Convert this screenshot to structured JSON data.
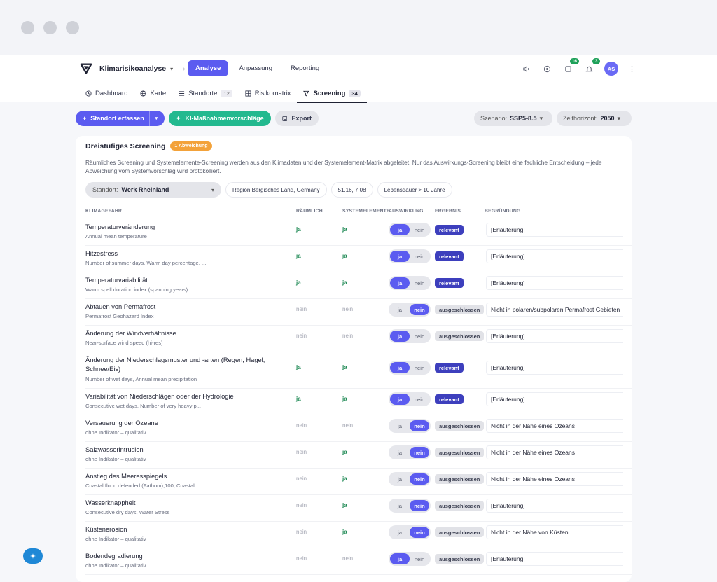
{
  "app": {
    "title": "Klimarisikoanalyse",
    "nav": [
      "Analyse",
      "Anpassung",
      "Reporting"
    ],
    "active_nav": "Analyse",
    "tasks_badge": "16",
    "notif_badge": "3",
    "avatar": "AS"
  },
  "subnav": [
    {
      "label": "Dashboard",
      "icon": "clock-icon",
      "count": ""
    },
    {
      "label": "Karte",
      "icon": "globe-icon",
      "count": ""
    },
    {
      "label": "Standorte",
      "icon": "list-icon",
      "count": "12"
    },
    {
      "label": "Risikomatrix",
      "icon": "grid-icon",
      "count": ""
    },
    {
      "label": "Screening",
      "icon": "filter-icon",
      "count": "34"
    }
  ],
  "toolbar": {
    "add_site": "Standort erfassen",
    "ai_suggestions": "KI-Maßnahmenvorschläge",
    "export": "Export",
    "scenario_label": "Szenario:",
    "scenario_value": "SSP5-8.5",
    "horizon_label": "Zeithorizont:",
    "horizon_value": "2050"
  },
  "screening": {
    "title": "Dreistufiges Screening",
    "deviation_badge": "1 Abweichung",
    "description": "Räumliches Screening und Systemelemente-Screening werden aus den Klimadaten und der Systemelement-Matrix abgeleitet. Nur das Auswirkungs-Screening bleibt eine fachliche Entscheidung – jede Abweichung vom Systemvorschlag wird protokolliert.",
    "site_label": "Standort:",
    "site_value": "Werk Rheinland",
    "chips": [
      "Region Bergisches Land, Germany",
      "51.16, 7.08",
      "Lebensdauer > 10 Jahre"
    ]
  },
  "table": {
    "headers": [
      "KLIMAGEFAHR",
      "RÄUMLICH",
      "SYSTEMELEMENTE",
      "AUSWIRKUNG",
      "ERGEBNIS",
      "BEGRÜNDUNG"
    ],
    "toggle_labels": [
      "ja",
      "nein"
    ],
    "rows": [
      {
        "name": "Temperaturveränderung",
        "sub": "Annual mean temperature",
        "spatial": "ja",
        "system": "ja",
        "impact": "ja",
        "result": "relevant",
        "reason": "[Erläuterung]"
      },
      {
        "name": "Hitzestress",
        "sub": "Number of summer days, Warm day percentage, ...",
        "spatial": "ja",
        "system": "ja",
        "impact": "ja",
        "result": "relevant",
        "reason": "[Erläuterung]"
      },
      {
        "name": "Temperaturvariabilität",
        "sub": "Warm spell duration index (spanning years)",
        "spatial": "ja",
        "system": "ja",
        "impact": "ja",
        "result": "relevant",
        "reason": "[Erläuterung]"
      },
      {
        "name": "Abtauen von Permafrost",
        "sub": "Permafrost Geohazard Index",
        "spatial": "nein",
        "system": "nein",
        "impact": "nein",
        "result": "ausgeschlossen",
        "reason": "Nicht in polaren/subpolaren Permafrost Gebieten"
      },
      {
        "name": "Änderung der Windverhältnisse",
        "sub": "Near-surface wind speed (hi-res)",
        "spatial": "nein",
        "system": "nein",
        "impact": "ja",
        "result": "ausgeschlossen",
        "reason": "[Erläuterung]"
      },
      {
        "name": "Änderung der Niederschlagsmuster und -arten (Regen, Hagel, Schnee/Eis)",
        "sub": "Number of wet days, Annual mean precipitation",
        "spatial": "ja",
        "system": "ja",
        "impact": "ja",
        "result": "relevant",
        "reason": "[Erläuterung]"
      },
      {
        "name": "Variabilität von Niederschlägen oder der Hydrologie",
        "sub": "Consecutive wet days, Number of very heavy p...",
        "spatial": "ja",
        "system": "ja",
        "impact": "ja",
        "result": "relevant",
        "reason": "[Erläuterung]"
      },
      {
        "name": "Versauerung der Ozeane",
        "sub": "ohne Indikator – qualitativ",
        "spatial": "nein",
        "system": "nein",
        "impact": "nein",
        "result": "ausgeschlossen",
        "reason": "Nicht in der Nähe eines Ozeans"
      },
      {
        "name": "Salzwasserintrusion",
        "sub": "ohne Indikator – qualitativ",
        "spatial": "nein",
        "system": "ja",
        "impact": "nein",
        "result": "ausgeschlossen",
        "reason": "Nicht in der Nähe eines Ozeans"
      },
      {
        "name": "Anstieg des Meeresspiegels",
        "sub": "Coastal flood defended (Fathom),100, Coastal...",
        "spatial": "nein",
        "system": "ja",
        "impact": "nein",
        "result": "ausgeschlossen",
        "reason": "Nicht in der Nähe eines Ozeans"
      },
      {
        "name": "Wasserknappheit",
        "sub": "Consecutive dry days, Water Stress",
        "spatial": "nein",
        "system": "ja",
        "impact": "nein",
        "result": "ausgeschlossen",
        "reason": "[Erläuterung]"
      },
      {
        "name": "Küstenerosion",
        "sub": "ohne Indikator – qualitativ",
        "spatial": "nein",
        "system": "ja",
        "impact": "nein",
        "result": "ausgeschlossen",
        "reason": "Nicht in der Nähe von Küsten"
      },
      {
        "name": "Bodendegradierung",
        "sub": "ohne Indikator – qualitativ",
        "spatial": "nein",
        "system": "nein",
        "impact": "ja",
        "result": "ausgeschlossen",
        "reason": "[Erläuterung]"
      }
    ]
  }
}
